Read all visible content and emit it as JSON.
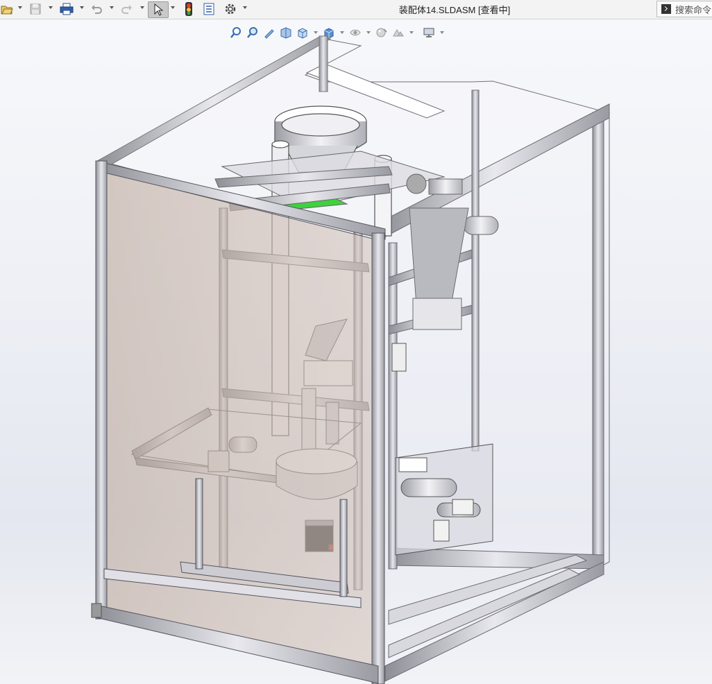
{
  "window": {
    "title": "装配体14.SLDASM [查看中]",
    "search_placeholder": "搜索命令"
  },
  "toolbar": {
    "items": [
      "open-icon",
      "save-icon",
      "print-icon",
      "undo-icon",
      "redo-icon",
      "select-icon",
      "rebuild-icon",
      "file-properties-icon",
      "options-icon"
    ]
  },
  "heads_up_toolbar": {
    "items": [
      "zoom-to-fit-icon",
      "zoom-to-area-icon",
      "previous-view-icon",
      "section-view-icon",
      "view-orientation-icon",
      "display-style-icon",
      "hide-show-items-icon",
      "edit-appearance-icon",
      "apply-scene-icon",
      "view-settings-icon"
    ]
  },
  "colors": {
    "frame": "#b8b8bf",
    "panel_tint": "#b49c8c",
    "accent_green": "#3fd13f",
    "background": "#eef0f6"
  }
}
